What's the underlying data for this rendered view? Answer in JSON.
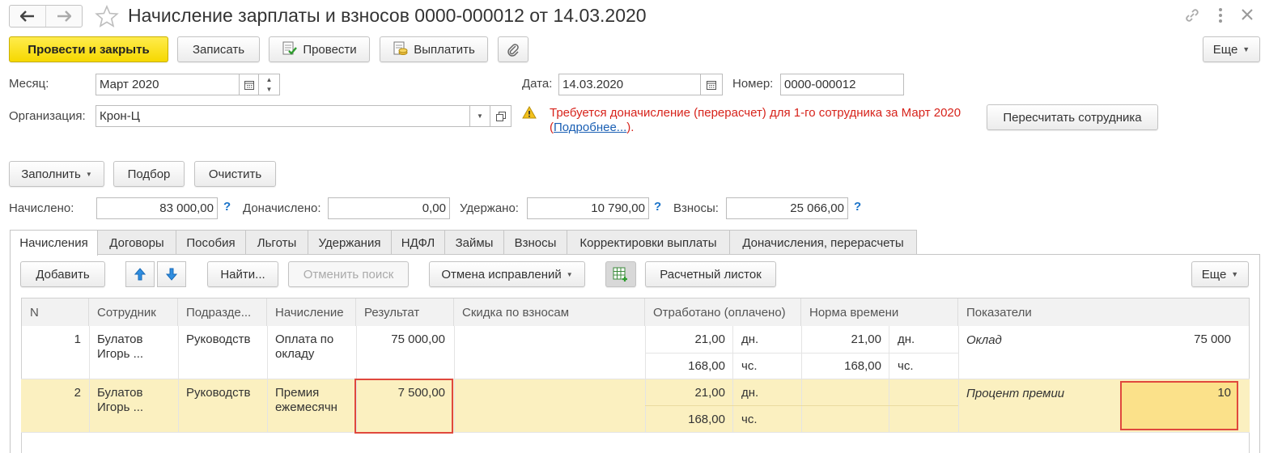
{
  "window": {
    "title": "Начисление зарплаты и взносов 0000-000012 от 14.03.2020"
  },
  "toolbar": {
    "post_close": "Провести и закрыть",
    "save": "Записать",
    "post": "Провести",
    "pay": "Выплатить",
    "more": "Еще"
  },
  "form": {
    "month_label": "Месяц:",
    "month_value": "Март 2020",
    "date_label": "Дата:",
    "date_value": "14.03.2020",
    "number_label": "Номер:",
    "number_value": "0000-000012",
    "org_label": "Организация:",
    "org_value": "Крон-Ц",
    "warning_text": "Требуется доначисление (перерасчет) для 1-го сотрудника за Март 2020",
    "warning_open": "(",
    "warning_link": "Подробнее...",
    "warning_close": ").",
    "recalc_button": "Пересчитать сотрудника"
  },
  "actions": {
    "fill": "Заполнить",
    "pick": "Подбор",
    "clear": "Очистить"
  },
  "totals": {
    "accrued_label": "Начислено:",
    "accrued_value": "83 000,00",
    "additional_label": "Доначислено:",
    "additional_value": "0,00",
    "withheld_label": "Удержано:",
    "withheld_value": "10 790,00",
    "contrib_label": "Взносы:",
    "contrib_value": "25 066,00",
    "help": "?"
  },
  "tabs": [
    "Начисления",
    "Договоры",
    "Пособия",
    "Льготы",
    "Удержания",
    "НДФЛ",
    "Займы",
    "Взносы",
    "Корректировки выплаты",
    "Доначисления, перерасчеты"
  ],
  "table_toolbar": {
    "add": "Добавить",
    "find": "Найти...",
    "cancel_search": "Отменить поиск",
    "cancel_fixes": "Отмена исправлений",
    "payslip": "Расчетный листок",
    "more": "Еще"
  },
  "columns": [
    "N",
    "Сотрудник",
    "Подразде...",
    "Начисление",
    "Результат",
    "Скидка по взносам",
    "Отработано (оплачено)",
    "Норма времени",
    "Показатели"
  ],
  "rows": [
    {
      "n": "1",
      "employee_1": "Булатов",
      "employee_2": "Игорь ...",
      "dept": "Руководств",
      "accrual_1": "Оплата по",
      "accrual_2": "окладу",
      "result": "75 000,00",
      "worked_days": "21,00",
      "unit_days": "дн.",
      "worked_hours": "168,00",
      "unit_hours": "чс.",
      "norm_days": "21,00",
      "norm_unit_days": "дн.",
      "norm_hours": "168,00",
      "norm_unit_hours": "чс.",
      "indicator": "Оклад",
      "indicator_value": "75 000"
    },
    {
      "n": "2",
      "employee_1": "Булатов",
      "employee_2": "Игорь ...",
      "dept": "Руководств",
      "accrual_1": "Премия",
      "accrual_2": "ежемесячн",
      "result": "7 500,00",
      "worked_days": "21,00",
      "unit_days": "дн.",
      "worked_hours": "168,00",
      "unit_hours": "чс.",
      "indicator": "Процент премии",
      "indicator_value": "10"
    }
  ]
}
